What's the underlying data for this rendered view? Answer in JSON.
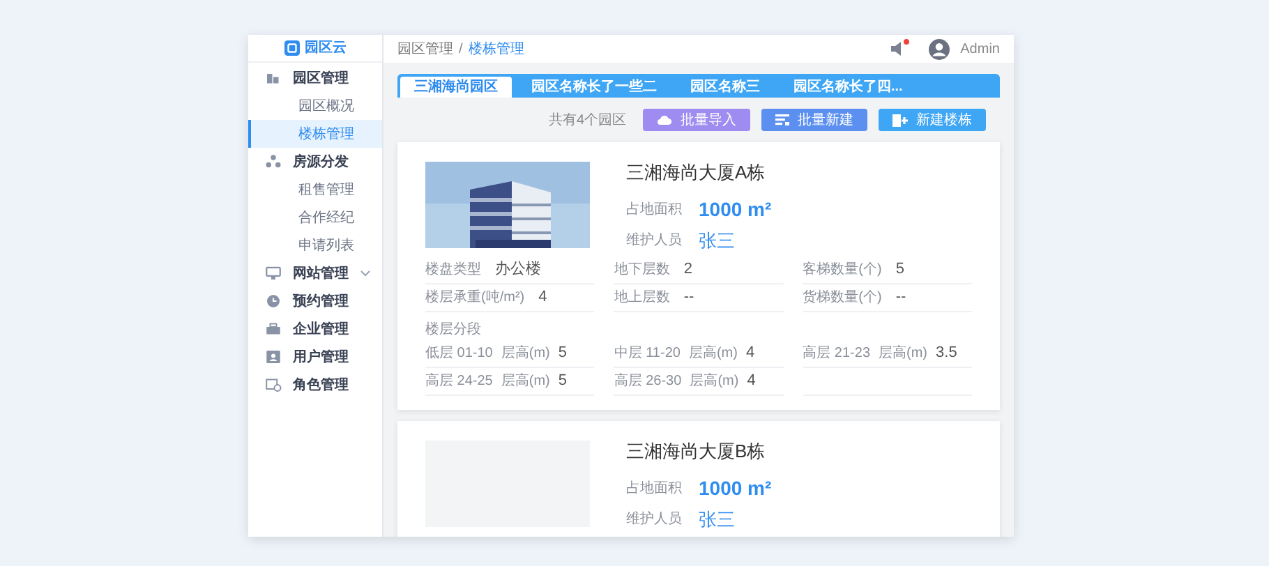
{
  "sidebar": {
    "logo": "园区云",
    "items": [
      {
        "label": "园区管理",
        "kind": "group",
        "children": [
          {
            "label": "园区概况",
            "selected": false
          },
          {
            "label": "楼栋管理",
            "selected": true
          }
        ]
      },
      {
        "label": "房源分发",
        "kind": "group",
        "children": [
          {
            "label": "租售管理",
            "selected": false
          },
          {
            "label": "合作经纪",
            "selected": false
          },
          {
            "label": "申请列表",
            "selected": false
          }
        ]
      },
      {
        "label": "网站管理",
        "kind": "submenu"
      },
      {
        "label": "预约管理",
        "kind": "group"
      },
      {
        "label": "企业管理",
        "kind": "group"
      },
      {
        "label": "用户管理",
        "kind": "group"
      },
      {
        "label": "角色管理",
        "kind": "group"
      }
    ]
  },
  "header": {
    "breadcrumb": [
      "园区管理",
      "楼栋管理"
    ],
    "separator": "/",
    "notification": {
      "unread": true
    },
    "user": "Admin"
  },
  "tabs": [
    {
      "label": "三湘海尚园区",
      "selected": true
    },
    {
      "label": "园区名称长了一些二",
      "selected": false
    },
    {
      "label": "园区名称三",
      "selected": false
    },
    {
      "label": "园区名称长了四...",
      "selected": false
    }
  ],
  "toolbar": {
    "count": "共有4个园区",
    "buttons": [
      {
        "label": "批量导入",
        "kind": "import"
      },
      {
        "label": "批量新建",
        "kind": "batch"
      },
      {
        "label": "新建楼栋",
        "kind": "new"
      }
    ]
  },
  "buildings": [
    {
      "title": "三湘海尚大厦A栋",
      "image": {
        "kind": "picture"
      },
      "area_label": "占地面积",
      "area": "1000 m²",
      "keeper_label": "维护人员",
      "keeper": "张三",
      "fields": [
        {
          "label": "楼盘类型",
          "value": "办公楼"
        },
        {
          "label": "地下层数",
          "value": "2"
        },
        {
          "label": "客梯数量(个)",
          "value": "5"
        },
        {
          "label": "楼层承重(吨/m²)",
          "value": "4"
        },
        {
          "label": "地上层数",
          "value": "--"
        },
        {
          "label": "货梯数量(个)",
          "value": "--"
        }
      ],
      "segments_label": "楼层分段",
      "segments": [
        {
          "range": "低层 01-10",
          "label": "层高(m)",
          "value": "5"
        },
        {
          "range": "中层 11-20",
          "label": "层高(m)",
          "value": "4"
        },
        {
          "range": "高层 21-23",
          "label": "层高(m)",
          "value": "3.5"
        },
        {
          "range": "高层 24-25",
          "label": "层高(m)",
          "value": "5"
        },
        {
          "range": "高层 26-30",
          "label": "层高(m)",
          "value": "4"
        }
      ]
    },
    {
      "title": "三湘海尚大厦B栋",
      "image": {
        "kind": "empty"
      },
      "area_label": "占地面积",
      "area": "1000 m²",
      "keeper_label": "维护人员",
      "keeper": "张三"
    }
  ]
}
